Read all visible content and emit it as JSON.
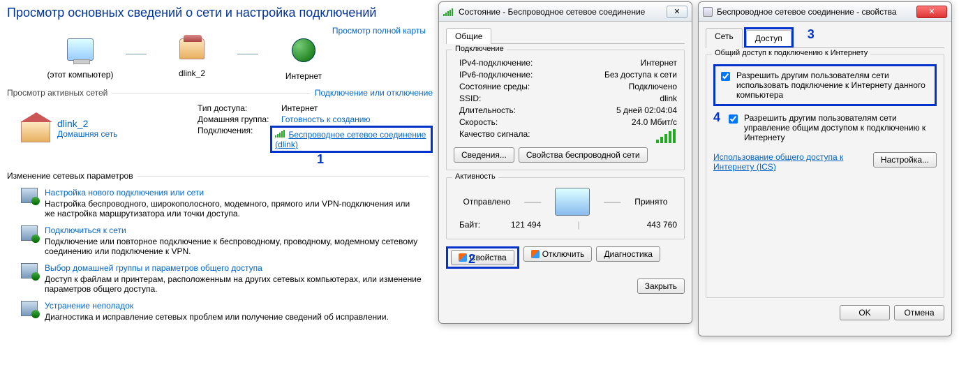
{
  "netcenter": {
    "title": "Просмотр основных сведений о сети и настройка подключений",
    "view_full_map": "Просмотр полной карты",
    "map": {
      "this_pc": "(этот компьютер)",
      "router": "dlink_2",
      "internet": "Интернет"
    },
    "active_nets_label": "Просмотр активных сетей",
    "connect_disconnect": "Подключение или отключение",
    "network": {
      "name": "dlink_2",
      "type": "Домашняя сеть",
      "access_type_lbl": "Тип доступа:",
      "access_type_val": "Интернет",
      "homegroup_lbl": "Домашняя группа:",
      "homegroup_val": "Готовность к созданию",
      "connections_lbl": "Подключения:",
      "connection_link": "Беспроводное сетевое соединение (dlink)"
    },
    "params_title": "Изменение сетевых параметров",
    "tasks": [
      {
        "title": "Настройка нового подключения или сети",
        "desc": "Настройка беспроводного, широкополосного, модемного, прямого или VPN-подключения или же настройка маршрутизатора или точки доступа."
      },
      {
        "title": "Подключиться к сети",
        "desc": "Подключение или повторное подключение к беспроводному, проводному, модемному сетевому соединению или подключение к VPN."
      },
      {
        "title": "Выбор домашней группы и параметров общего доступа",
        "desc": "Доступ к файлам и принтерам, расположенным на других сетевых компьютерах, или изменение параметров общего доступа."
      },
      {
        "title": "Устранение неполадок",
        "desc": "Диагностика и исправление сетевых проблем или получение сведений об исправлении."
      }
    ],
    "callouts": {
      "c1": "1",
      "c2": "2",
      "c3": "3",
      "c4": "4"
    }
  },
  "status": {
    "title": "Состояние - Беспроводное сетевое соединение",
    "tab_general": "Общие",
    "grp_connection": "Подключение",
    "rows": {
      "ipv4_l": "IPv4-подключение:",
      "ipv4_v": "Интернет",
      "ipv6_l": "IPv6-подключение:",
      "ipv6_v": "Без доступа к сети",
      "media_l": "Состояние среды:",
      "media_v": "Подключено",
      "ssid_l": "SSID:",
      "ssid_v": "dlink",
      "dur_l": "Длительность:",
      "dur_v": "5 дней 02:04:04",
      "spd_l": "Скорость:",
      "spd_v": "24.0 Мбит/с",
      "sig_l": "Качество сигнала:"
    },
    "btn_details": "Сведения...",
    "btn_wprops": "Свойства беспроводной сети",
    "grp_activity": "Активность",
    "sent": "Отправлено",
    "recv": "Принято",
    "bytes_l": "Байт:",
    "bytes_sent": "121 494",
    "bytes_recv": "443 760",
    "btn_props": "Свойства",
    "btn_disable": "Отключить",
    "btn_diag": "Диагностика",
    "btn_close": "Закрыть"
  },
  "props": {
    "title": "Беспроводное сетевое соединение - свойства",
    "tab_net": "Сеть",
    "tab_access": "Доступ",
    "grp": "Общий доступ к подключению к Интернету",
    "chk1": "Разрешить другим пользователям сети использовать подключение к Интернету данного компьютера",
    "chk2": "Разрешить другим пользователям сети управление общим доступом к подключению к Интернету",
    "ics_link": "Использование общего доступа к Интернету (ICS)",
    "btn_settings": "Настройка...",
    "btn_ok": "OK",
    "btn_cancel": "Отмена"
  }
}
